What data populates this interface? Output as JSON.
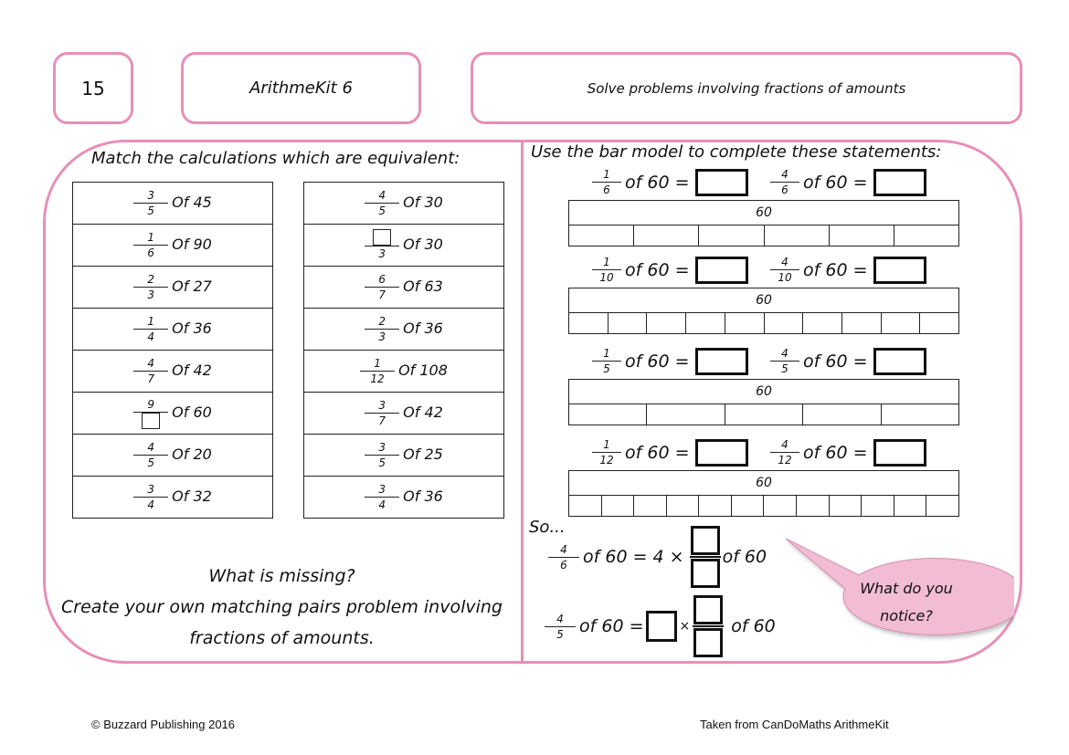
{
  "header": {
    "page_number": "15",
    "kit_title": "ArithmeKit 6",
    "objective": "Solve problems involving fractions of amounts"
  },
  "left": {
    "heading": "Match the calculations which are equivalent:",
    "column_a": [
      {
        "num": "3",
        "den": "5",
        "text": "Of 45"
      },
      {
        "num": "1",
        "den": "6",
        "text": "Of 90"
      },
      {
        "num": "2",
        "den": "3",
        "text": "Of 27"
      },
      {
        "num": "1",
        "den": "4",
        "text": "Of 36"
      },
      {
        "num": "4",
        "den": "7",
        "text": "Of 42"
      },
      {
        "num": "9",
        "den": "",
        "den_blank": true,
        "text": "Of 60"
      },
      {
        "num": "4",
        "den": "5",
        "text": "Of 20"
      },
      {
        "num": "3",
        "den": "4",
        "text": "Of 32"
      }
    ],
    "column_b": [
      {
        "num": "4",
        "den": "5",
        "text": "Of 30"
      },
      {
        "num": "",
        "num_blank": true,
        "den": "3",
        "text": "Of 30"
      },
      {
        "num": "6",
        "den": "7",
        "text": "Of 63"
      },
      {
        "num": "2",
        "den": "3",
        "text": "Of 36"
      },
      {
        "num": "1",
        "den": "12",
        "text": "Of 108"
      },
      {
        "num": "3",
        "den": "7",
        "text": "Of 42"
      },
      {
        "num": "3",
        "den": "5",
        "text": "Of 25"
      },
      {
        "num": "3",
        "den": "4",
        "text": "Of 36"
      }
    ],
    "prompt_line1": "What is missing?",
    "prompt_line2": "Create your own matching pairs problem involving",
    "prompt_line3": "fractions of amounts."
  },
  "right": {
    "heading": "Use the bar model to complete these statements:",
    "models": [
      {
        "unit_num": "1",
        "nonunit_num": "4",
        "den": "6",
        "of_text": "of 60 =",
        "whole": "60",
        "parts": 6
      },
      {
        "unit_num": "1",
        "nonunit_num": "4",
        "den": "10",
        "of_text": "of 60 =",
        "whole": "60",
        "parts": 10
      },
      {
        "unit_num": "1",
        "nonunit_num": "4",
        "den": "5",
        "of_text": "of 60 =",
        "whole": "60",
        "parts": 5
      },
      {
        "unit_num": "1",
        "nonunit_num": "4",
        "den": "12",
        "of_text": "of 60 =",
        "whole": "60",
        "parts": 12
      }
    ],
    "so_label": "So...",
    "eq1": {
      "num": "4",
      "den": "6",
      "left_text": "of 60 = 4 ×",
      "right_text": "of 60"
    },
    "eq2": {
      "num": "4",
      "den": "5",
      "left_text": "of 60 =",
      "times": "×",
      "right_text": "of 60"
    },
    "bubble_text_line1": "What do you",
    "bubble_text_line2": "notice?"
  },
  "footer": {
    "left": "© Buzzard Publishing 2016",
    "right": "Taken from CanDoMaths ArithmeKit"
  },
  "colors": {
    "accent_pink": "#e78fb8",
    "bubble_fill": "#f2bcd5"
  }
}
